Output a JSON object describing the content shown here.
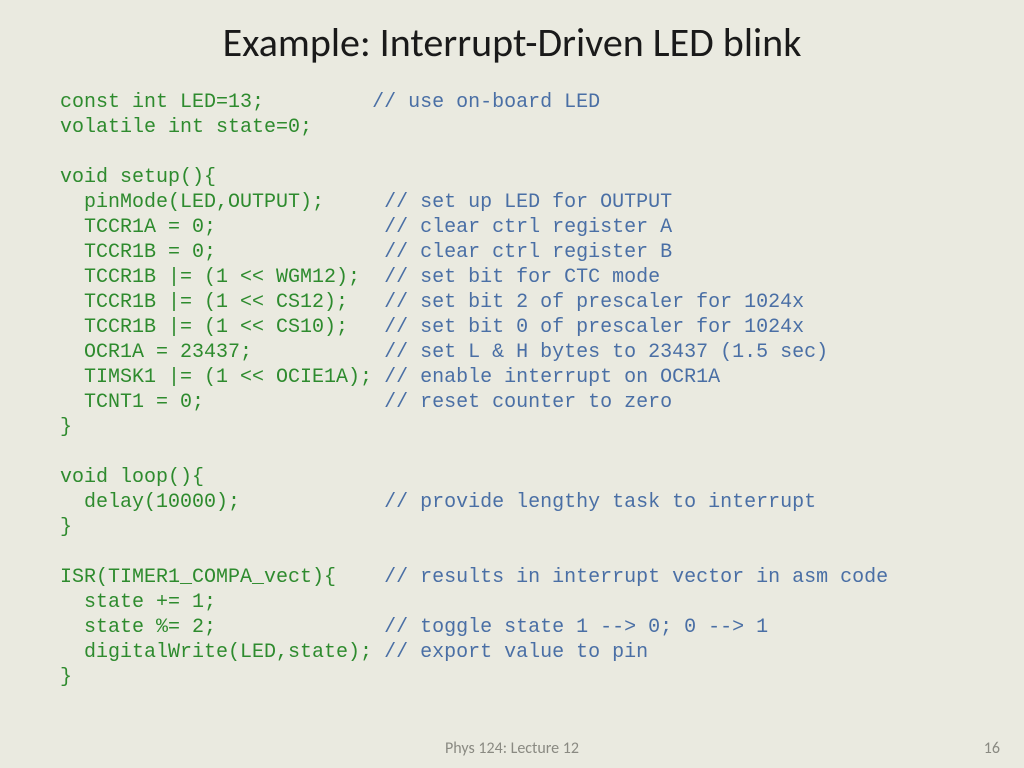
{
  "title": "Example: Interrupt-Driven LED blink",
  "footer": {
    "left": "Phys 124: Lecture 12",
    "right": "16"
  },
  "code": {
    "l1": {
      "g": "const int LED=13;         ",
      "b": "// use on-board LED"
    },
    "l2": {
      "g": "volatile int state=0;"
    },
    "l3": {
      "g": ""
    },
    "l4": {
      "g": "void setup(){"
    },
    "l5": {
      "g": "  pinMode(LED,OUTPUT);     ",
      "b": "// set up LED for OUTPUT"
    },
    "l6": {
      "g": "  TCCR1A = 0;              ",
      "b": "// clear ctrl register A"
    },
    "l7": {
      "g": "  TCCR1B = 0;              ",
      "b": "// clear ctrl register B"
    },
    "l8": {
      "g": "  TCCR1B |= (1 << WGM12);  ",
      "b": "// set bit for CTC mode"
    },
    "l9": {
      "g": "  TCCR1B |= (1 << CS12);   ",
      "b": "// set bit 2 of prescaler for 1024x"
    },
    "l10": {
      "g": "  TCCR1B |= (1 << CS10);   ",
      "b": "// set bit 0 of prescaler for 1024x"
    },
    "l11": {
      "g": "  OCR1A = 23437;           ",
      "b": "// set L & H bytes to 23437 (1.5 sec)"
    },
    "l12": {
      "g": "  TIMSK1 |= (1 << OCIE1A); ",
      "b": "// enable interrupt on OCR1A"
    },
    "l13": {
      "g": "  TCNT1 = 0;               ",
      "b": "// reset counter to zero"
    },
    "l14": {
      "g": "}"
    },
    "l15": {
      "g": ""
    },
    "l16": {
      "g": "void loop(){"
    },
    "l17": {
      "g": "  delay(10000);            ",
      "b": "// provide lengthy task to interrupt"
    },
    "l18": {
      "g": "}"
    },
    "l19": {
      "g": ""
    },
    "l20": {
      "g": "ISR(TIMER1_COMPA_vect){    ",
      "b": "// results in interrupt vector in asm code"
    },
    "l21": {
      "g": "  state += 1;"
    },
    "l22": {
      "g": "  state %= 2;              ",
      "b": "// toggle state 1 --> 0; 0 --> 1"
    },
    "l23": {
      "g": "  digitalWrite(LED,state); ",
      "b": "// export value to pin"
    },
    "l24": {
      "g": "}"
    }
  }
}
